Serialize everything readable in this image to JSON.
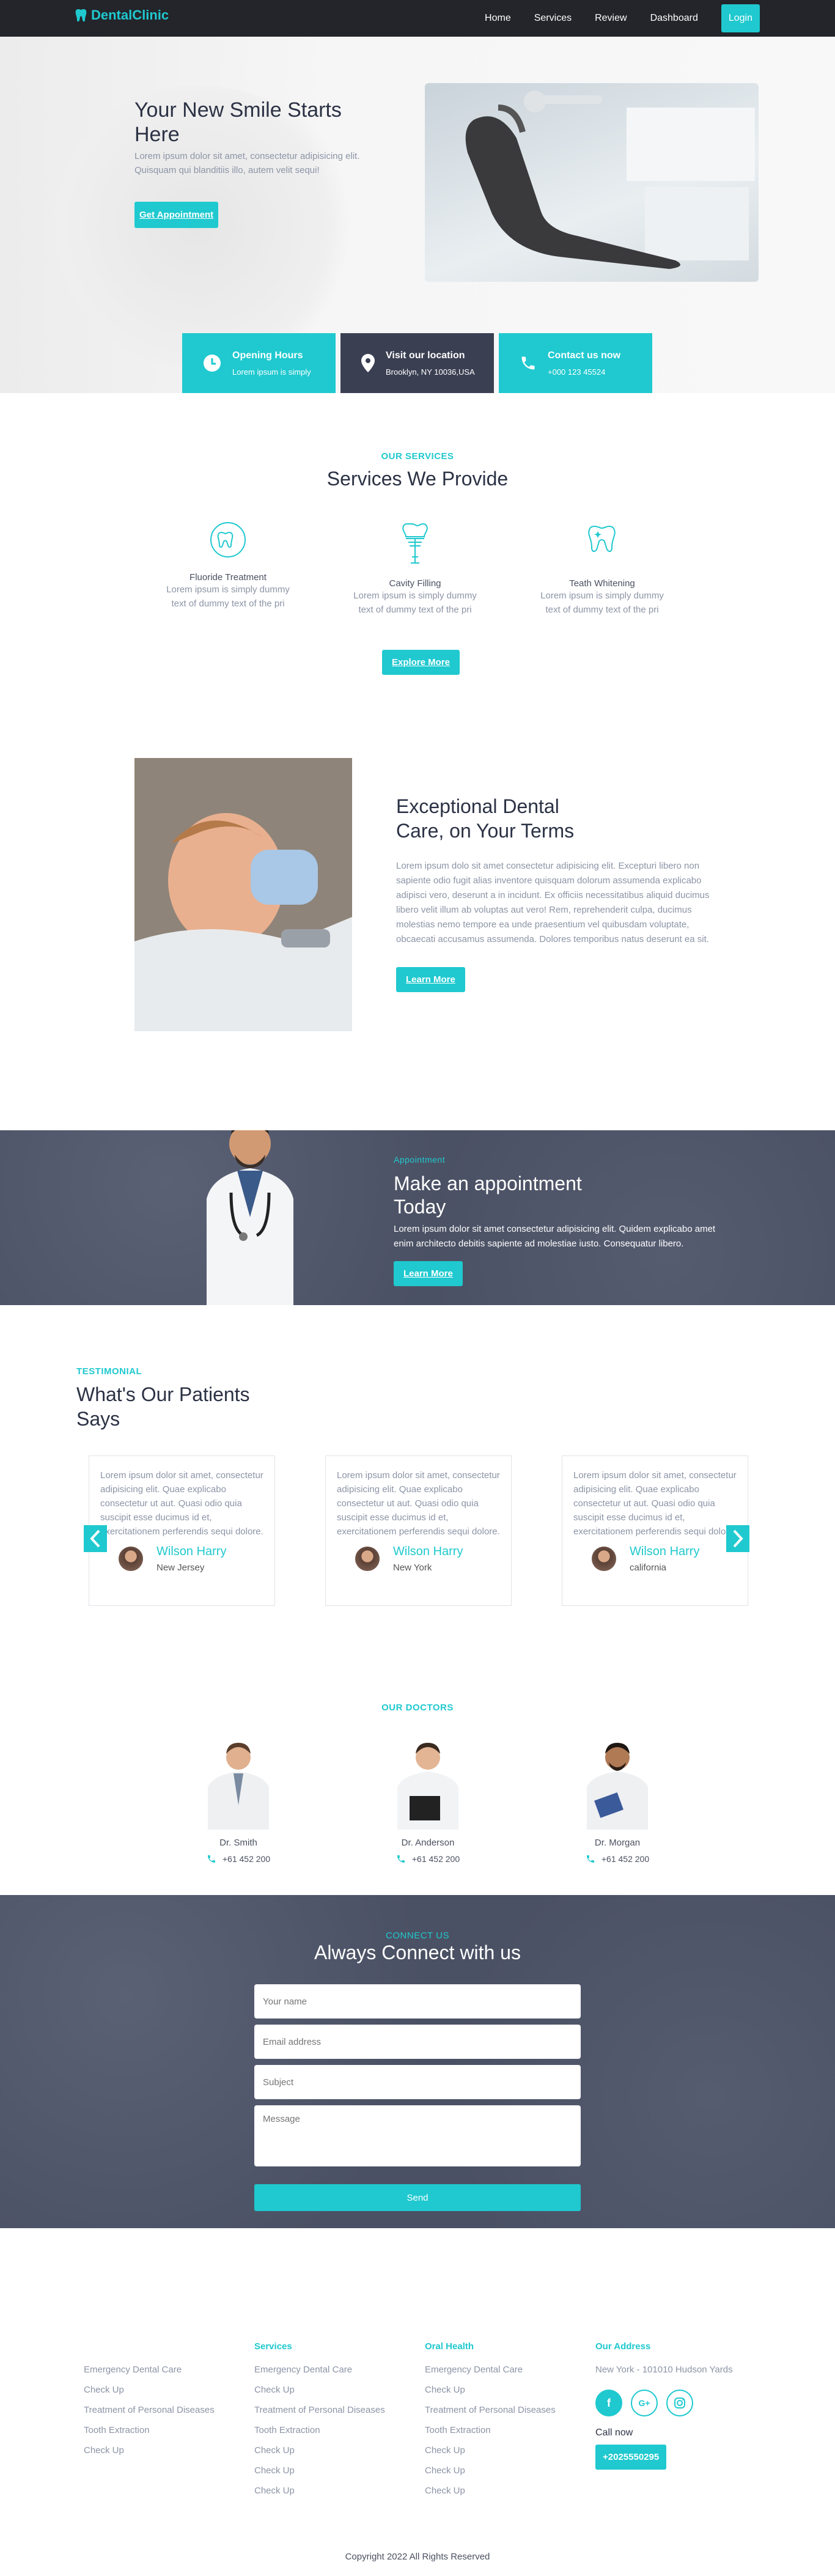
{
  "nav": {
    "brand": "DentalClinic",
    "items": [
      "Home",
      "Services",
      "Review",
      "Dashboard"
    ],
    "login": "Login"
  },
  "hero": {
    "title": "Your New Smile Starts Here",
    "text": "Lorem ipsum dolor sit amet, consectetur adipisicing elit. Quisquam qui blanditiis illo, autem velit sequi!",
    "button": "Get Appointment",
    "cards": [
      {
        "title": "Opening Hours",
        "text": "Lorem ipsum is simply"
      },
      {
        "title": "Visit our location",
        "text": "Brooklyn, NY 10036,USA"
      },
      {
        "title": "Contact us now",
        "text": "+000 123 45524"
      }
    ]
  },
  "services": {
    "eyebrow": "OUR SERVICES",
    "title": "Services We Provide",
    "items": [
      {
        "name": "Fluoride Treatment",
        "desc": "Lorem ipsum is simply dummy text of dummy text of the pri"
      },
      {
        "name": "Cavity Filling",
        "desc": "Lorem ipsum is simply dummy text of dummy text of the pri"
      },
      {
        "name": "Teath Whitening",
        "desc": "Lorem ipsum is simply dummy text of dummy text of the pri"
      }
    ],
    "button": "Explore More"
  },
  "about": {
    "title": "Exceptional Dental Care, on Your Terms",
    "text": "Lorem ipsum dolo sit amet consectetur adipisicing elit. Excepturi libero non sapiente odio fugit alias inventore quisquam dolorum assumenda explicabo adipisci vero, deserunt a in incidunt. Ex officiis necessitatibus aliquid ducimus libero velit illum ab voluptas aut vero! Rem, reprehenderit culpa, ducimus molestias nemo tempore ea unde praesentium vel quibusdam voluptate, obcaecati accusamus assumenda. Dolores temporibus natus deserunt ea sit.",
    "button": "Learn More"
  },
  "appointment": {
    "eyebrow": "Appointment",
    "title": "Make an appointment Today",
    "text": "Lorem ipsum dolor sit amet consectetur adipisicing elit. Quidem explicabo amet enim architecto debitis sapiente ad molestiae iusto. Consequatur libero.",
    "button": "Learn More"
  },
  "testimonials": {
    "eyebrow": "TESTIMONIAL",
    "title": "What's Our Patients Says",
    "items": [
      {
        "text": "Lorem ipsum dolor sit amet, consectetur adipisicing elit. Quae explicabo consectetur ut aut. Quasi odio quia suscipit esse ducimus id et, exercitationem perferendis sequi dolore.",
        "name": "Wilson Harry",
        "location": "New Jersey"
      },
      {
        "text": "Lorem ipsum dolor sit amet, consectetur adipisicing elit. Quae explicabo consectetur ut aut. Quasi odio quia suscipit esse ducimus id et, exercitationem perferendis sequi dolore.",
        "name": "Wilson Harry",
        "location": "New York"
      },
      {
        "text": "Lorem ipsum dolor sit amet, consectetur adipisicing elit. Quae explicabo consectetur ut aut. Quasi odio quia suscipit esse ducimus id et, exercitationem perferendis sequi dolore.",
        "name": "Wilson Harry",
        "location": "california"
      }
    ]
  },
  "doctors": {
    "eyebrow": "OUR DOCTORS",
    "items": [
      {
        "name": "Dr. Smith",
        "phone": "+61 452 200"
      },
      {
        "name": "Dr. Anderson",
        "phone": "+61 452 200"
      },
      {
        "name": "Dr. Morgan",
        "phone": "+61 452 200"
      }
    ]
  },
  "contact": {
    "eyebrow": "CONNECT US",
    "title": "Always Connect with us",
    "name_placeholder": "Your name",
    "email_placeholder": "Email address",
    "subject_placeholder": "Subject",
    "message_placeholder": "Message",
    "send": "Send"
  },
  "footer": {
    "columns": [
      {
        "title": "",
        "items": [
          "Emergency Dental Care",
          "Check Up",
          "Treatment of Personal Diseases",
          "Tooth Extraction",
          "Check Up"
        ]
      },
      {
        "title": "Services",
        "items": [
          "Emergency Dental Care",
          "Check Up",
          "Treatment of Personal Diseases",
          "Tooth Extraction",
          "Check Up",
          "Check Up",
          "Check Up"
        ]
      },
      {
        "title": "Oral Health",
        "items": [
          "Emergency Dental Care",
          "Check Up",
          "Treatment of Personal Diseases",
          "Tooth Extraction",
          "Check Up",
          "Check Up",
          "Check Up"
        ]
      }
    ],
    "address_title": "Our Address",
    "address": "New York - 101010 Hudson Yards",
    "call_now": "Call now",
    "phone": "+2025550295",
    "copyright": "Copyright 2022 All Rights Reserved"
  },
  "colors": {
    "accent": "#1fc9cf",
    "dark": "#23252b",
    "slate": "#4b5164"
  }
}
